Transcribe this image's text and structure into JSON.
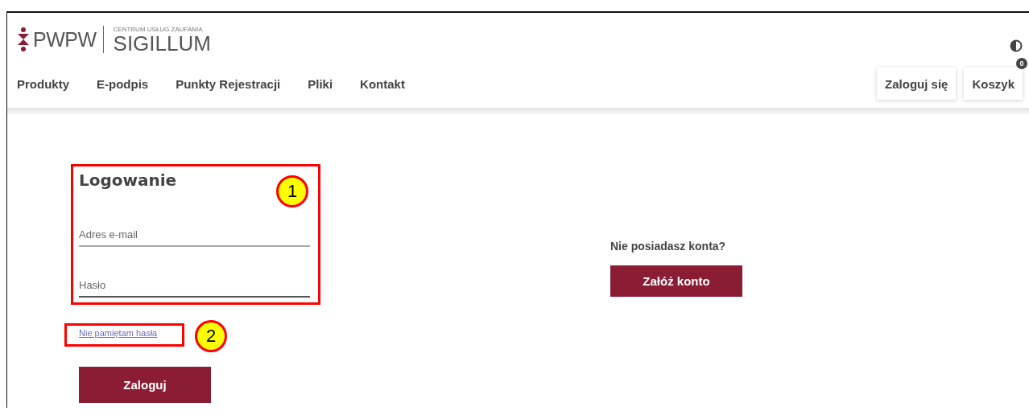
{
  "logo": {
    "brand": "PWPW",
    "subtitle": "CENTRUM USŁUG ZAUFANIA",
    "name": "SIGILLUM"
  },
  "nav": [
    {
      "label": "Produkty"
    },
    {
      "label": "E-podpis"
    },
    {
      "label": "Punkty Rejestracji"
    },
    {
      "label": "Pliki"
    },
    {
      "label": "Kontakt"
    }
  ],
  "header_buttons": {
    "login": "Zaloguj się",
    "cart": "Koszyk",
    "cart_count": "0"
  },
  "login": {
    "title": "Logowanie",
    "fields": [
      {
        "placeholder": "Adres e-mail"
      },
      {
        "placeholder": "Hasło"
      }
    ],
    "forgot_link": "Nie pamiętam hasła",
    "submit": "Zaloguj"
  },
  "register": {
    "prompt": "Nie posiadasz konta?",
    "button": "Załóż konto"
  },
  "callouts": [
    {
      "number": "1"
    },
    {
      "number": "2"
    }
  ]
}
